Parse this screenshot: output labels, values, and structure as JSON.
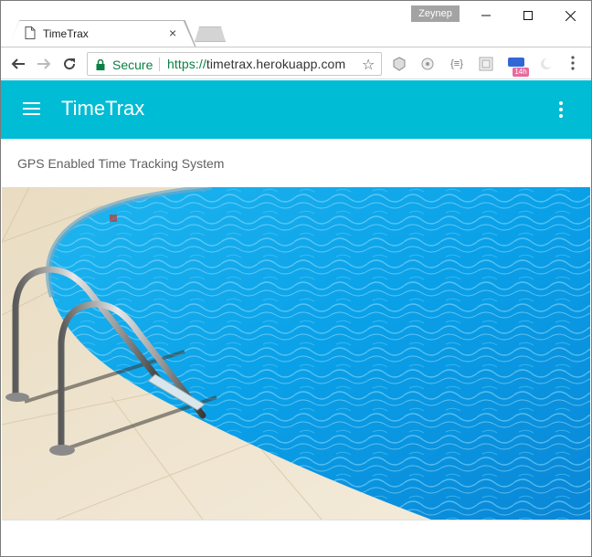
{
  "browser": {
    "profile_name": "Zeynep",
    "tab": {
      "title": "TimeTrax",
      "close_glyph": "×"
    },
    "omnibox": {
      "secure_label": "Secure",
      "url_scheme": "https://",
      "url_host": "timetrax.herokuapp.com"
    },
    "extension_badge": "14h"
  },
  "app": {
    "title": "TimeTrax",
    "subtitle": "GPS Enabled Time Tracking System",
    "accent_color": "#00bcd4"
  },
  "icons": {
    "menu": "hamburger-icon",
    "overflow": "more-vert-icon",
    "back": "arrow-left-icon",
    "forward": "arrow-right-icon",
    "reload": "reload-icon",
    "lock": "lock-icon",
    "star": "star-icon"
  }
}
